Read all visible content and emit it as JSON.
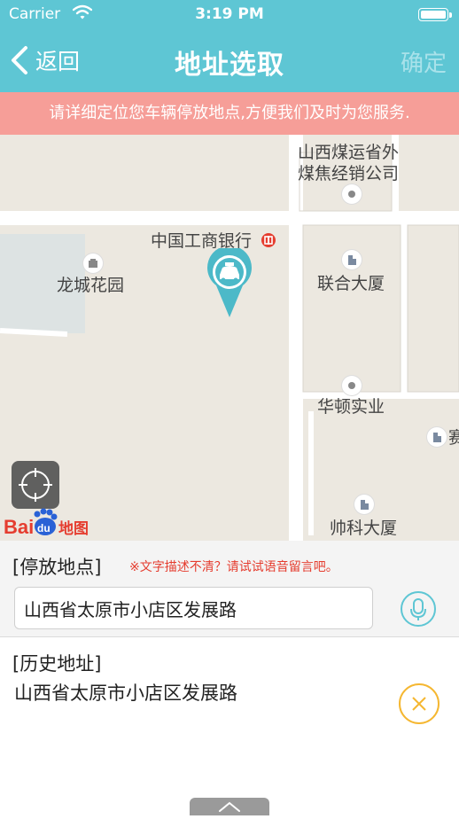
{
  "status_bar": {
    "carrier": "Carrier",
    "time": "3:19 PM"
  },
  "nav": {
    "back_label": "返回",
    "title": "地址选取",
    "confirm_label": "确定"
  },
  "notice": "请详细定位您车辆停放地点,方便我们及时为您服务.",
  "map": {
    "labels": {
      "coal_line1": "山西煤运省外",
      "coal_line2": "煤焦经销公司",
      "icbc": "中国工商银行",
      "longcheng": "龙城花园",
      "lianhe": "联合大厦",
      "huadun": "华顿实业",
      "sai": "赛",
      "shuaike": "帅科大厦"
    },
    "logo": {
      "bai": "Bai",
      "du": "du",
      "ditu": "地图"
    }
  },
  "form": {
    "label": "[停放地点]",
    "hint": "※文字描述不清？请试试语音留言吧。",
    "address_value": "山西省太原市小店区发展路"
  },
  "history": {
    "label": "[历史地址]",
    "items": [
      "山西省太原市小店区发展路"
    ]
  },
  "colors": {
    "accent": "#5ec6d4",
    "notice_bg": "#f69e98",
    "hint_red": "#e53d2f",
    "clear_yellow": "#f5b731"
  }
}
